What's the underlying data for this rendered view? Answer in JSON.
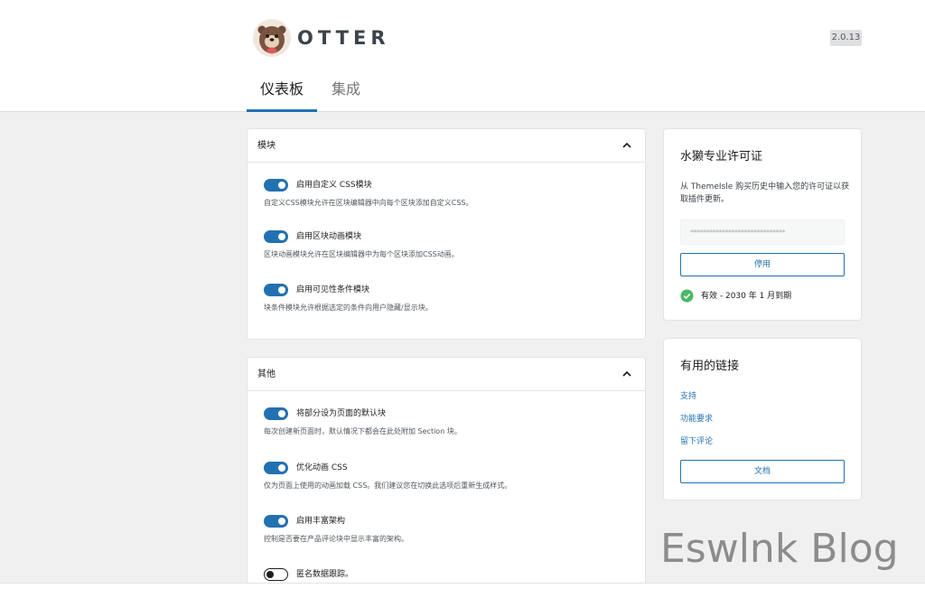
{
  "header": {
    "brand": "OTTER",
    "version": "2.0.13"
  },
  "tabs": [
    {
      "label": "仪表板",
      "active": true
    },
    {
      "label": "集成",
      "active": false
    }
  ],
  "modules_panel": {
    "title": "模块",
    "settings": [
      {
        "label": "启用自定义 CSS模块",
        "help": "自定义CSS模块允许在区块编辑器中向每个区块添加自定义CSS。",
        "enabled": true
      },
      {
        "label": "启用区块动画模块",
        "help": "区块动画模块允许在区块编辑器中为每个区块添加CSS动画。",
        "enabled": true
      },
      {
        "label": "启用可见性条件模块",
        "help": "块条件模块允许根据选定的条件向用户隐藏/显示块。",
        "enabled": true
      }
    ]
  },
  "other_panel": {
    "title": "其他",
    "settings": [
      {
        "label": "将部分设为页面的默认块",
        "help": "每次创建新页面时，默认情况下都会在此处附加 Section 块。",
        "enabled": true
      },
      {
        "label": "优化动画 CSS",
        "help": "仅为页面上使用的动画加载 CSS。我们建议您在切换此选项后重新生成样式。",
        "enabled": true
      },
      {
        "label": "启用丰富架构",
        "help": "控制是否要在产品评论块中显示丰富的架构。",
        "enabled": true
      },
      {
        "label": "匿名数据跟踪。",
        "help": "",
        "enabled": false
      }
    ]
  },
  "license": {
    "title": "水獭专业许可证",
    "description": "从 ThemeIsle 购买历史中输入您的许可证以获取插件更新。",
    "input_value": "******************************",
    "button": "停用",
    "status": "有效 - 2030 年 1 月到期"
  },
  "links": {
    "title": "有用的链接",
    "items": [
      "支持",
      "功能要求",
      "留下评论"
    ],
    "button": "文档"
  },
  "watermark": "Eswlnk Blog",
  "colors": {
    "accent": "#2271b1",
    "success": "#4ab866",
    "background": "#f0f0f1"
  }
}
